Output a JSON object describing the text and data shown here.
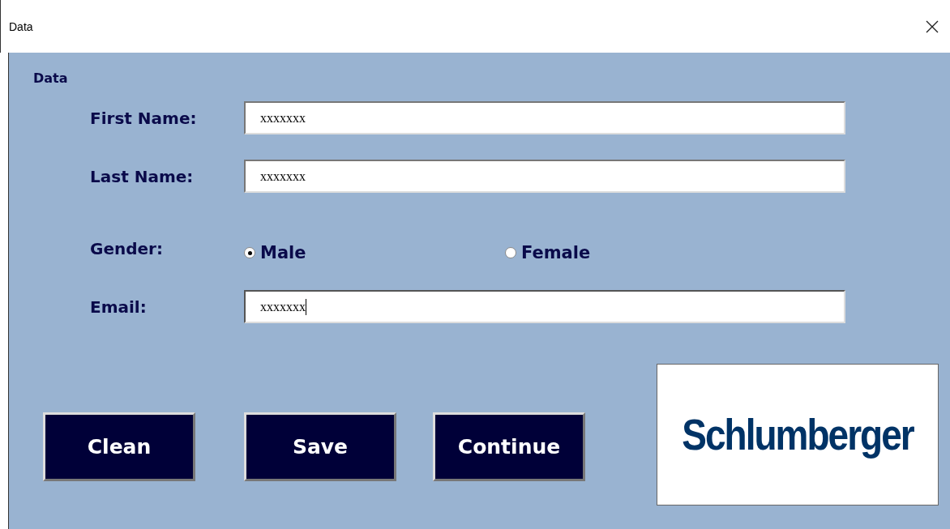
{
  "window": {
    "title": "Data"
  },
  "frame": {
    "label": "Data"
  },
  "fields": [
    {
      "kind": "text",
      "label": "First Name:",
      "value": "xxxxxxx",
      "focused": false
    },
    {
      "kind": "text",
      "label": "Last Name:",
      "value": "xxxxxxx",
      "focused": false
    },
    {
      "kind": "radio",
      "label": "Gender:",
      "options": [
        {
          "label": "Male",
          "selected": true
        },
        {
          "label": "Female",
          "selected": false
        }
      ]
    },
    {
      "kind": "text",
      "label": "Email:",
      "value": "xxxxxxx",
      "focused": true
    }
  ],
  "buttons": [
    "Clean",
    "Save",
    "Continue"
  ],
  "logo": {
    "text": "Schlumberger"
  }
}
